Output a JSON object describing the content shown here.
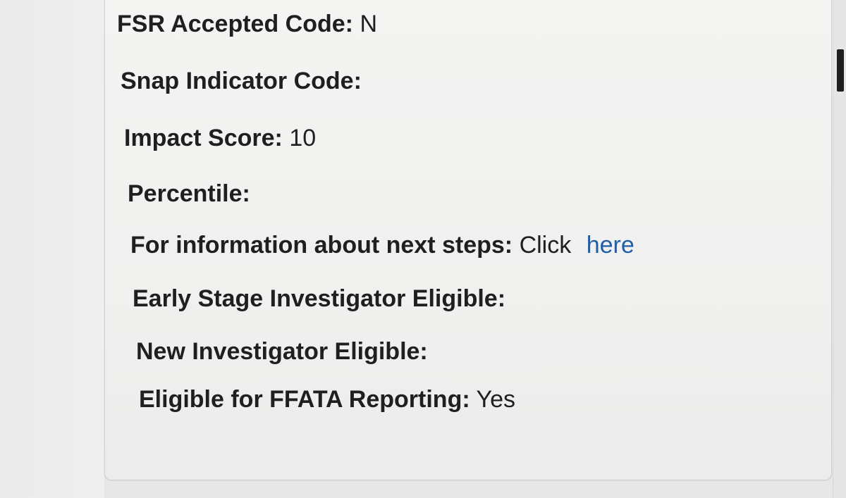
{
  "fields": [
    {
      "label": "FSR Accepted Code:",
      "value": "N"
    },
    {
      "label": "Snap Indicator Code:",
      "value": ""
    },
    {
      "label": "Impact Score:",
      "value": "10"
    },
    {
      "label": "Percentile:",
      "value": ""
    },
    {
      "label": "For information about next steps:",
      "value": "Click",
      "link": "here"
    },
    {
      "label": "Early Stage Investigator Eligible:",
      "value": ""
    },
    {
      "label": "New Investigator Eligible:",
      "value": ""
    },
    {
      "label": "Eligible for FFATA Reporting:",
      "value": "Yes"
    }
  ],
  "colors": {
    "text": "#1f1f1f",
    "link": "#1f5ea8",
    "panel_border": "#cdcecd"
  }
}
